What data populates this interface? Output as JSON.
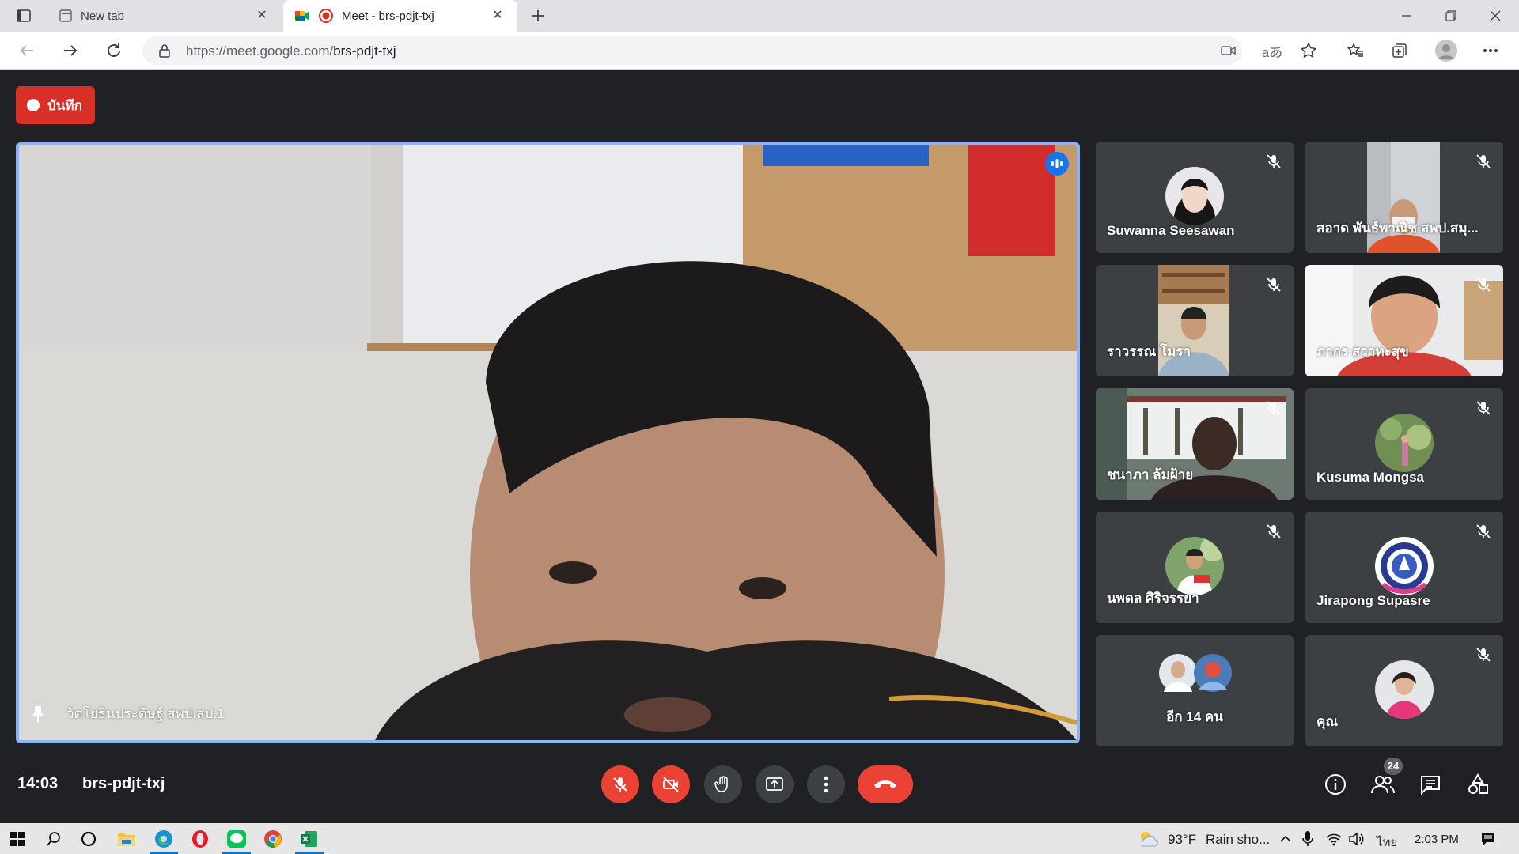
{
  "browser": {
    "tabs": [
      {
        "label": "New tab"
      },
      {
        "label": "Meet - brs-pdjt-txj"
      }
    ],
    "url_host": "https://meet.google.com/",
    "url_path": "brs-pdjt-txj"
  },
  "meet": {
    "record_label": "บันทึก",
    "main_speaker": "วัดโยธินประดิษฐ์ สพป.สป.1",
    "participants": [
      {
        "name": "Suwanna Seesawan"
      },
      {
        "name": "สอาด พันธ์พาณิช สพป.สมุ..."
      },
      {
        "name": "ราวรรณ โมรา"
      },
      {
        "name": "ภากร สวาทะสุข"
      },
      {
        "name": "ชนาภา ล้มฝ้าย"
      },
      {
        "name": "Kusuma Mongsa"
      },
      {
        "name": "นพดล ศิริจรรยา"
      },
      {
        "name": "Jirapong Supasre"
      },
      {
        "name": "อีก 14 คน"
      },
      {
        "name": "คุณ"
      }
    ],
    "time": "14:03",
    "meeting_code": "brs-pdjt-txj",
    "people_count": "24"
  },
  "taskbar": {
    "weather_temp": "93°F",
    "weather_text": "Rain sho...",
    "language": "ไทย",
    "clock": "2:03 PM"
  },
  "colors": {
    "accent_blue": "#8ab4f8",
    "red": "#ea4335",
    "meet_bg": "#202124",
    "tile_bg": "#3c4043"
  }
}
